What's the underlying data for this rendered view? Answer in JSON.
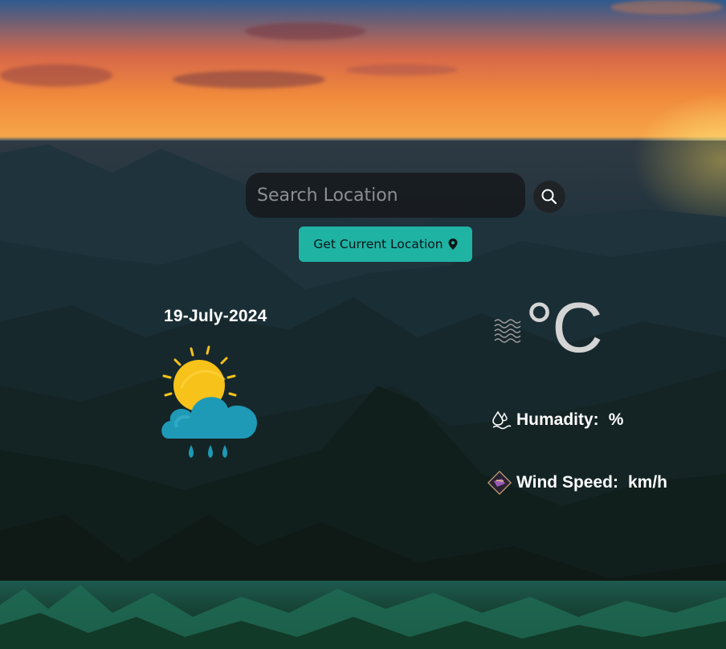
{
  "search": {
    "placeholder": "Search Location",
    "value": ""
  },
  "location_button": {
    "label": "Get Current Location",
    "icon": "map-pin-icon"
  },
  "weather": {
    "date": "19-July-2024",
    "icon": "sun-cloud-rain-icon",
    "temperature": "",
    "temperature_unit": "°C",
    "humidity_label": "Humadity:",
    "humidity_value": "",
    "humidity_unit": "%",
    "wind_label": "Wind Speed:",
    "wind_value": "",
    "wind_unit": "km/h"
  },
  "colors": {
    "accent": "#1fb3a4",
    "text": "#ffffff",
    "muted": "#d4d4d4"
  }
}
